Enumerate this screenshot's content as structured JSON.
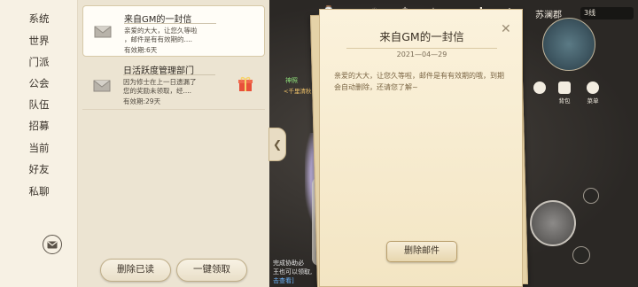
{
  "nav": {
    "items": [
      "系统",
      "世界",
      "门派",
      "公会",
      "队伍",
      "招募",
      "当前",
      "好友",
      "私聊"
    ]
  },
  "mail_list": {
    "items": [
      {
        "title": "来自GM的一封信",
        "preview": [
          "亲爱的大大，让您久等啦",
          "，邮件是有有效期的...."
        ],
        "expiry": "有效期:6天"
      },
      {
        "title": "日活跃度管理部门",
        "preview": [
          "因为修士在上一日遗漏了",
          "您的奖励未领取，经...."
        ],
        "expiry": "有效期:29天"
      }
    ],
    "delete_read_label": "删除已读",
    "claim_all_label": "一键领取"
  },
  "letter": {
    "title": "来自GM的一封信",
    "date": "2021—04—29",
    "body": "亲爱的大大，让您久等啦，邮件是有有效期的哦，到期会自动删除，还请您了解~",
    "delete_label": "删除邮件"
  },
  "hud": {
    "location": "苏澜郡",
    "line": "3线",
    "bag_label": "背包",
    "menu_label": "菜单"
  },
  "scene": {
    "npc_name": "神照",
    "npc_title": "<千里清秋>",
    "chat_lines": [
      "完成协助必",
      "王也可以领取,",
      "击查看]"
    ]
  },
  "colors": {
    "letter_text": "#7a6544",
    "panel_bg": "#f7f1e4",
    "npc_name": "#8ee07a"
  }
}
